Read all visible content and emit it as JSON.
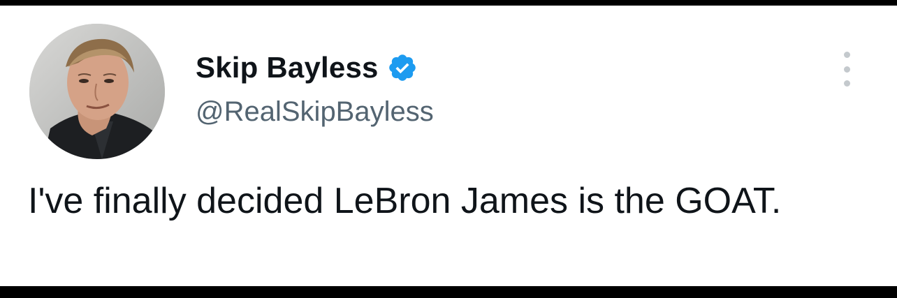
{
  "tweet": {
    "author": {
      "display_name": "Skip Bayless",
      "handle": "@RealSkipBayless",
      "verified": true,
      "verified_icon": "verified-badge-icon",
      "avatar_icon": "avatar"
    },
    "text": "I've finally decided LeBron James is the GOAT.",
    "menu_icon": "more-options-icon"
  },
  "colors": {
    "text_primary": "#0f1419",
    "text_secondary": "#536471",
    "verified_blue": "#1d9bf0",
    "background": "#ffffff",
    "frame": "#000000"
  }
}
